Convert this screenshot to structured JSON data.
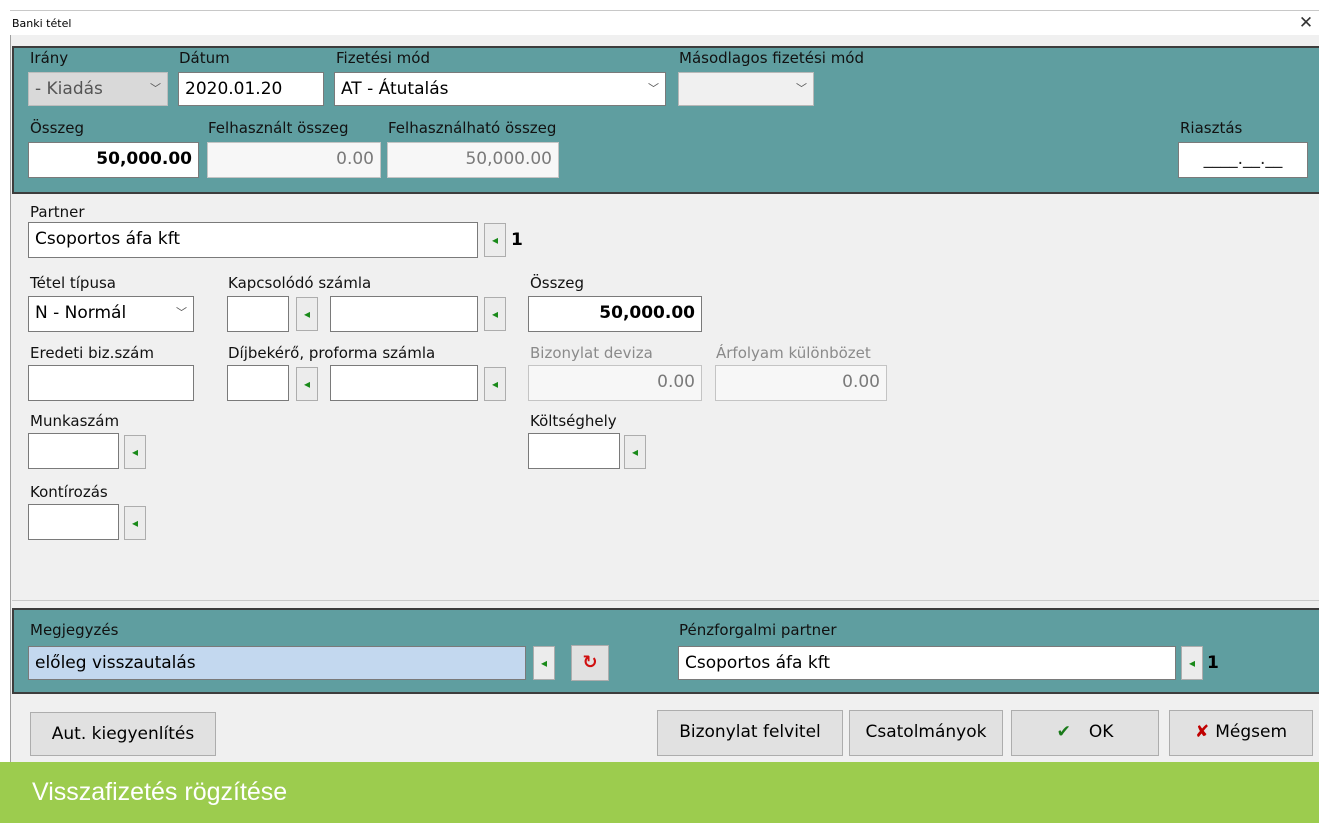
{
  "window": {
    "title": "Banki tétel",
    "close_glyph": "✕"
  },
  "top_panel": {
    "irany": {
      "label": "Irány",
      "value": "-   Kiadás"
    },
    "datum": {
      "label": "Dátum",
      "value": "2020.01.20"
    },
    "fizetesi_mod": {
      "label": "Fizetési mód",
      "value": "AT - Átutalás"
    },
    "masodlagos_fizetesi_mod": {
      "label": "Másodlagos fizetési mód",
      "value": ""
    },
    "osszeg": {
      "label": "Összeg",
      "value": "50,000.00"
    },
    "felhasznalt_osszeg": {
      "label": "Felhasznált összeg",
      "value": "0.00"
    },
    "felhasznalhato_osszeg": {
      "label": "Felhasználható összeg",
      "value": "50,000.00"
    },
    "riasztas": {
      "label": "Riasztás",
      "value": "____.__.__"
    }
  },
  "main": {
    "partner": {
      "label": "Partner",
      "value": "Csoportos áfa kft",
      "count": "1"
    },
    "tetel_tipusa": {
      "label": "Tétel típusa",
      "value": "N - Normál"
    },
    "kapcsolodo_szamla": {
      "label": "Kapcsolódó számla",
      "value1": "",
      "value2": ""
    },
    "osszeg": {
      "label": "Összeg",
      "value": "50,000.00"
    },
    "eredeti_biz_szam": {
      "label": "Eredeti biz.szám",
      "value": ""
    },
    "dijbekero": {
      "label": "Díjbekérő, proforma számla",
      "value1": "",
      "value2": ""
    },
    "bizonylat_deviza": {
      "label": "Bizonylat deviza",
      "value": "0.00"
    },
    "arfolyam_kulonbozet": {
      "label": "Árfolyam különbözet",
      "value": "0.00"
    },
    "munkaszam": {
      "label": "Munkaszám",
      "value": ""
    },
    "koltseghely": {
      "label": "Költséghely",
      "value": ""
    },
    "kontirozas": {
      "label": "Kontírozás",
      "value": ""
    }
  },
  "bottom_panel": {
    "megjegyzes": {
      "label": "Megjegyzés",
      "value": "előleg visszautalás"
    },
    "penzforgalmi_partner": {
      "label": "Pénzforgalmi partner",
      "value": "Csoportos áfa kft",
      "count": "1"
    }
  },
  "buttons": {
    "aut_kiegyenlites": "Aut. kiegyenlítés",
    "bizonylat_felvitel": "Bizonylat felvitel",
    "csatolmanyok": "Csatolmányok",
    "ok": "OK",
    "ok_glyph": "✔",
    "megsem": "Mégsem",
    "megsem_glyph": "✘"
  },
  "icons": {
    "picker": "arrow-left-icon",
    "reset": "undo-icon"
  },
  "colors": {
    "panel": "#5f9ea0",
    "banner": "#9ccc4e",
    "highlight": "#c3d8ef"
  },
  "banner": {
    "text": "Visszafizetés rögzítése"
  }
}
